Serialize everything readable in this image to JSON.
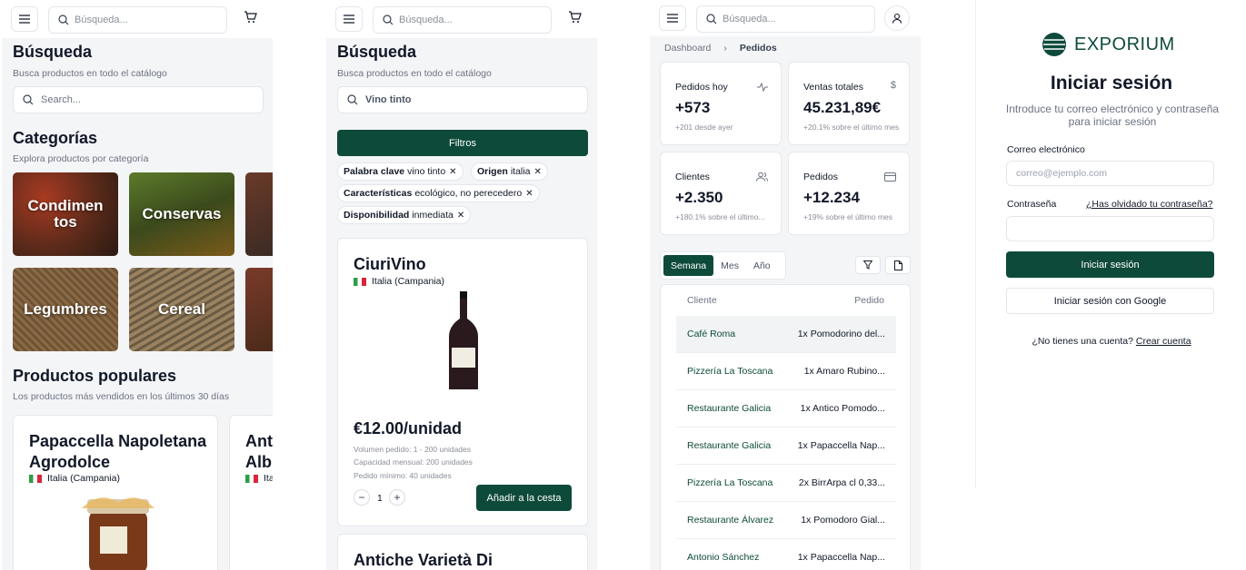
{
  "screen1": {
    "search_placeholder": "Búsqueda...",
    "title": "Búsqueda",
    "subtitle": "Busca productos en todo el catálogo",
    "search_input_placeholder": "Search...",
    "categories_title": "Categorías",
    "categories_subtitle": "Explora productos por categoría",
    "categories": [
      "Condimentos",
      "Conservas",
      "Legumbres",
      "Cereal"
    ],
    "popular_title": "Productos populares",
    "popular_subtitle": "Los productos más vendidos en los últimos 30 días",
    "products": [
      {
        "name": "Papaccella Napoletana Agrodolce",
        "origin": "Italia (Campania)"
      },
      {
        "name": "Antiche Varietà Albi",
        "origin": "Ita"
      }
    ]
  },
  "screen2": {
    "search_placeholder": "Búsqueda...",
    "title": "Búsqueda",
    "subtitle": "Busca productos en todo el catálogo",
    "search_value": "Vino tinto",
    "filters_button": "Filtros",
    "chips": [
      {
        "key": "Palabra clave",
        "value": "vino tinto"
      },
      {
        "key": "Origen",
        "value": "italia"
      },
      {
        "key": "Características",
        "value": "ecológico, no perecedero"
      },
      {
        "key": "Disponibilidad",
        "value": "inmediata"
      }
    ],
    "product": {
      "name": "CiuriVino",
      "origin": "Italia (Campania)",
      "price": "€12.00/unidad",
      "volume": "Volumen pedido: 1 - 200 unidades",
      "capacity": "Capacidad mensual: 200 unidades",
      "min_order": "Pedido mínimo: 40 unidades",
      "quantity": "1",
      "add_button": "Añadir a la cesta"
    },
    "next_product": "Antiche Varietà Di"
  },
  "screen3": {
    "search_placeholder": "Búsqueda...",
    "breadcrumb": {
      "home": "Dashboard",
      "current": "Pedidos"
    },
    "stats": [
      {
        "label": "Pedidos hoy",
        "value": "+573",
        "sub": "+201 desde ayer",
        "icon": "activity-icon"
      },
      {
        "label": "Ventas totales",
        "value": "45.231,89€",
        "sub": "+20.1% sobre el último mes",
        "icon": "dollar-icon"
      },
      {
        "label": "Clientes",
        "value": "+2.350",
        "sub": "+180.1% sobre el último...",
        "icon": "users-icon"
      },
      {
        "label": "Pedidos",
        "value": "+12.234",
        "sub": "+19% sobre el último mes",
        "icon": "card-icon"
      }
    ],
    "tabs": [
      "Semana",
      "Mes",
      "Año"
    ],
    "table": {
      "headers": [
        "Cliente",
        "Pedido"
      ],
      "rows": [
        {
          "client": "Café Roma",
          "order": "1x Pomodorino del..."
        },
        {
          "client": "Pizzería La Toscana",
          "order": "1x Amaro Rubino..."
        },
        {
          "client": "Restaurante Galicia",
          "order": "1x Antico Pomodo..."
        },
        {
          "client": "Restaurante Galicia",
          "order": "1x Papaccella Nap..."
        },
        {
          "client": "Pizzería La Toscana",
          "order": "2x BirrArpa cl 0,33..."
        },
        {
          "client": "Restaurante Álvarez",
          "order": "1x Pomodoro Gial..."
        },
        {
          "client": "Antonio Sánchez",
          "order": "1x Papaccella Nap..."
        }
      ]
    }
  },
  "screen4": {
    "brand": "EXPORIUM",
    "title": "Iniciar sesión",
    "subtitle": "Introduce tu correo electrónico y contraseña para iniciar sesión",
    "email_label": "Correo electrónico",
    "email_placeholder": "correo@ejemplo.com",
    "password_label": "Contraseña",
    "forgot_link": "¿Has olvidado tu contraseña?",
    "login_button": "Iniciar sesión",
    "google_button": "Iniciar sesión con Google",
    "no_account": "¿No tienes una cuenta?",
    "signup_link": "Crear cuenta"
  },
  "colors": {
    "accent": "#0e4a3a",
    "background": "#f4f5f7"
  }
}
